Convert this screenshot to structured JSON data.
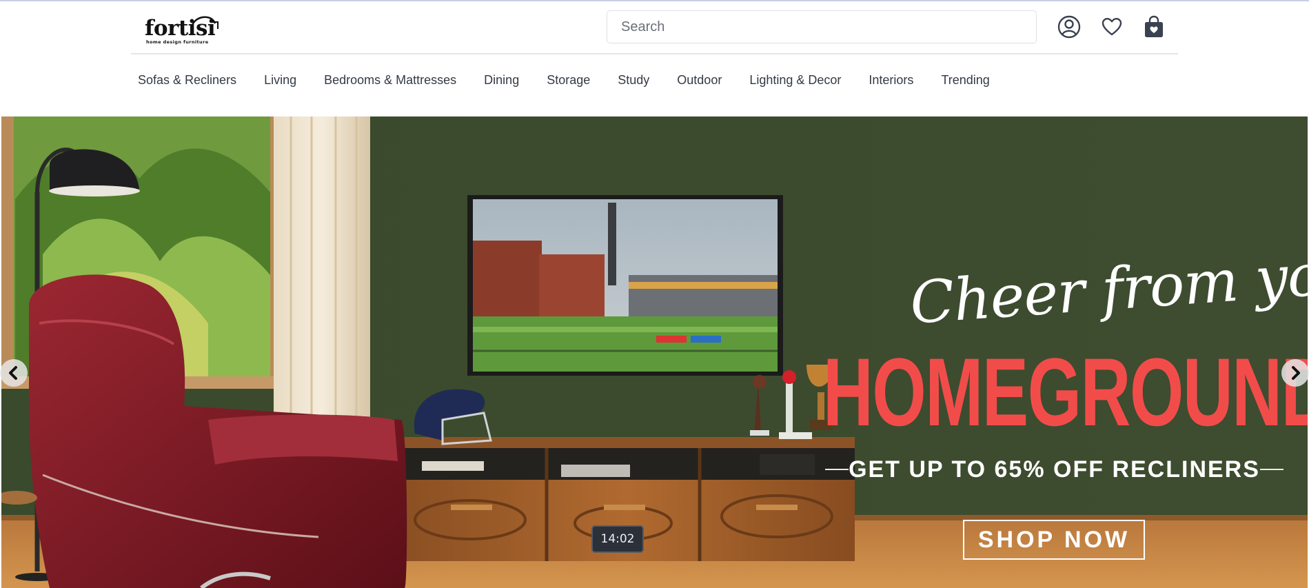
{
  "brand": {
    "name": "fortisi",
    "tagline": "home design furniture"
  },
  "search": {
    "placeholder": "Search"
  },
  "header_icons": [
    "account-icon",
    "wishlist-heart-icon",
    "shopping-bag-icon"
  ],
  "nav": {
    "items": [
      "Sofas & Recliners",
      "Living",
      "Bedrooms & Mattresses",
      "Dining",
      "Storage",
      "Study",
      "Outdoor",
      "Lighting & Decor",
      "Interiors",
      "Trending"
    ]
  },
  "banner": {
    "script_line": "Cheer from your",
    "headline": "HOMEGROUND!",
    "offer": "GET UP TO 65% OFF RECLINERS",
    "cta": "SHOP NOW",
    "clock": "14:02"
  },
  "colors": {
    "headline_red": "#f24c4a",
    "wall_green": "#3b4a2d",
    "nav_text": "#333a44",
    "recliner_red": "#7a1822"
  }
}
